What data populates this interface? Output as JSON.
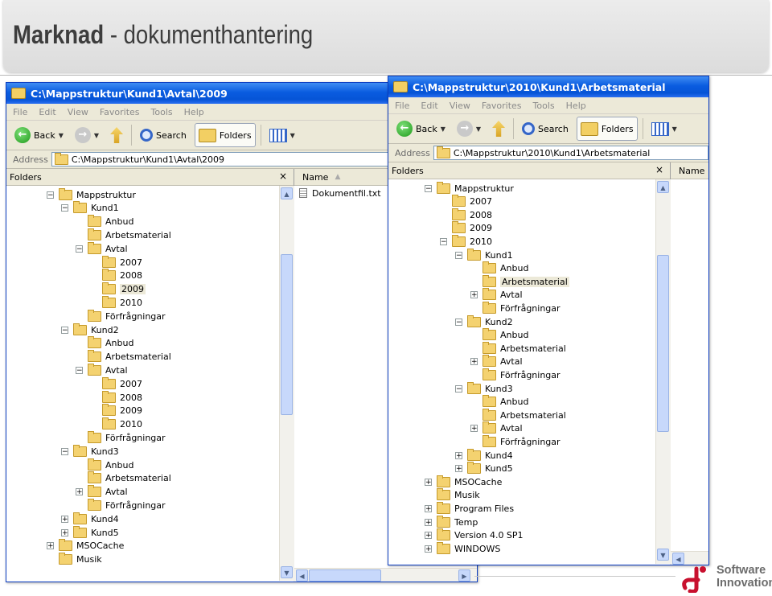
{
  "slide": {
    "title_bold": "Marknad",
    "title_rest": " - dokumenthantering"
  },
  "menu": [
    "File",
    "Edit",
    "View",
    "Favorites",
    "Tools",
    "Help"
  ],
  "toolbar": {
    "back": "Back",
    "search": "Search",
    "folders": "Folders"
  },
  "address_label": "Address",
  "folders_label": "Folders",
  "close_glyph": "×",
  "name_column": "Name",
  "window1": {
    "title": "C:\\Mappstruktur\\Kund1\\Avtal\\2009",
    "address": "C:\\Mappstruktur\\Kund1\\Avtal\\2009",
    "files": [
      "Dokumentfil.txt"
    ],
    "tree": [
      {
        "label": "Mappstruktur",
        "level": 0,
        "exp": "−"
      },
      {
        "label": "Kund1",
        "level": 1,
        "exp": "−"
      },
      {
        "label": "Anbud",
        "level": 2,
        "exp": ""
      },
      {
        "label": "Arbetsmaterial",
        "level": 2,
        "exp": ""
      },
      {
        "label": "Avtal",
        "level": 2,
        "exp": "−"
      },
      {
        "label": "2007",
        "level": 3,
        "exp": ""
      },
      {
        "label": "2008",
        "level": 3,
        "exp": ""
      },
      {
        "label": "2009",
        "level": 3,
        "exp": "",
        "hl": true
      },
      {
        "label": "2010",
        "level": 3,
        "exp": ""
      },
      {
        "label": "Förfrågningar",
        "level": 2,
        "exp": ""
      },
      {
        "label": "Kund2",
        "level": 1,
        "exp": "−"
      },
      {
        "label": "Anbud",
        "level": 2,
        "exp": ""
      },
      {
        "label": "Arbetsmaterial",
        "level": 2,
        "exp": ""
      },
      {
        "label": "Avtal",
        "level": 2,
        "exp": "−"
      },
      {
        "label": "2007",
        "level": 3,
        "exp": ""
      },
      {
        "label": "2008",
        "level": 3,
        "exp": ""
      },
      {
        "label": "2009",
        "level": 3,
        "exp": ""
      },
      {
        "label": "2010",
        "level": 3,
        "exp": ""
      },
      {
        "label": "Förfrågningar",
        "level": 2,
        "exp": ""
      },
      {
        "label": "Kund3",
        "level": 1,
        "exp": "−"
      },
      {
        "label": "Anbud",
        "level": 2,
        "exp": ""
      },
      {
        "label": "Arbetsmaterial",
        "level": 2,
        "exp": ""
      },
      {
        "label": "Avtal",
        "level": 2,
        "exp": "+"
      },
      {
        "label": "Förfrågningar",
        "level": 2,
        "exp": ""
      },
      {
        "label": "Kund4",
        "level": 1,
        "exp": "+"
      },
      {
        "label": "Kund5",
        "level": 1,
        "exp": "+"
      },
      {
        "label": "MSOCache",
        "level": 0,
        "exp": "+"
      },
      {
        "label": "Musik",
        "level": 0,
        "exp": ""
      }
    ]
  },
  "window2": {
    "title": "C:\\Mappstruktur\\2010\\Kund1\\Arbetsmaterial",
    "address": "C:\\Mappstruktur\\2010\\Kund1\\Arbetsmaterial",
    "tree": [
      {
        "label": "Mappstruktur",
        "level": 0,
        "exp": "−"
      },
      {
        "label": "2007",
        "level": 1,
        "exp": ""
      },
      {
        "label": "2008",
        "level": 1,
        "exp": ""
      },
      {
        "label": "2009",
        "level": 1,
        "exp": ""
      },
      {
        "label": "2010",
        "level": 1,
        "exp": "−"
      },
      {
        "label": "Kund1",
        "level": 2,
        "exp": "−"
      },
      {
        "label": "Anbud",
        "level": 3,
        "exp": ""
      },
      {
        "label": "Arbetsmaterial",
        "level": 3,
        "exp": "",
        "hl": true
      },
      {
        "label": "Avtal",
        "level": 3,
        "exp": "+"
      },
      {
        "label": "Förfrågningar",
        "level": 3,
        "exp": ""
      },
      {
        "label": "Kund2",
        "level": 2,
        "exp": "−"
      },
      {
        "label": "Anbud",
        "level": 3,
        "exp": ""
      },
      {
        "label": "Arbetsmaterial",
        "level": 3,
        "exp": ""
      },
      {
        "label": "Avtal",
        "level": 3,
        "exp": "+"
      },
      {
        "label": "Förfrågningar",
        "level": 3,
        "exp": ""
      },
      {
        "label": "Kund3",
        "level": 2,
        "exp": "−"
      },
      {
        "label": "Anbud",
        "level": 3,
        "exp": ""
      },
      {
        "label": "Arbetsmaterial",
        "level": 3,
        "exp": ""
      },
      {
        "label": "Avtal",
        "level": 3,
        "exp": "+"
      },
      {
        "label": "Förfrågningar",
        "level": 3,
        "exp": ""
      },
      {
        "label": "Kund4",
        "level": 2,
        "exp": "+"
      },
      {
        "label": "Kund5",
        "level": 2,
        "exp": "+"
      },
      {
        "label": "MSOCache",
        "level": 0,
        "exp": "+"
      },
      {
        "label": "Musik",
        "level": 0,
        "exp": ""
      },
      {
        "label": "Program Files",
        "level": 0,
        "exp": "+"
      },
      {
        "label": "Temp",
        "level": 0,
        "exp": "+"
      },
      {
        "label": "Version 4.0 SP1",
        "level": 0,
        "exp": "+"
      },
      {
        "label": "WINDOWS",
        "level": 0,
        "exp": "+"
      }
    ]
  },
  "logo": {
    "line1": "Software",
    "line2": "Innovation"
  },
  "colors": {
    "titlebar": "#0a5ce0",
    "brand_red": "#c8102e"
  }
}
